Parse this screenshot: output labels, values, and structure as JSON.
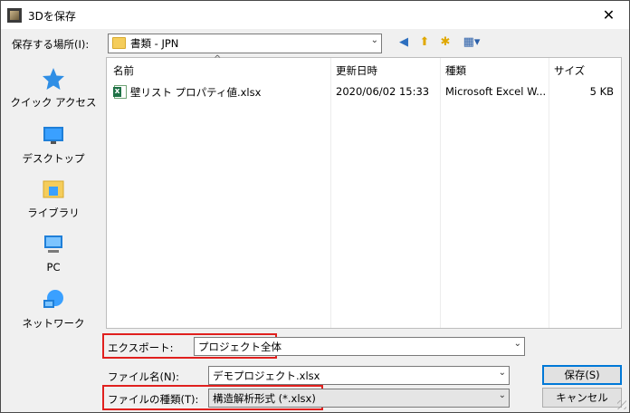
{
  "window": {
    "title": "3Dを保存",
    "close_glyph": "✕"
  },
  "location": {
    "label": "保存する場所(I):",
    "value": "書類 - JPN",
    "arrow": "⌄"
  },
  "toolbar": [
    {
      "name": "back-icon",
      "glyph": "◀",
      "color": "#2d6fbf"
    },
    {
      "name": "up-folder-icon",
      "glyph": "⬆",
      "color": "#e0a800"
    },
    {
      "name": "new-folder-icon",
      "glyph": "✱",
      "color": "#e0a800"
    },
    {
      "name": "view-menu-icon",
      "glyph": "▦▾",
      "color": "#2a5fa8"
    }
  ],
  "places": [
    {
      "name": "quick-access",
      "label": "クイック アクセス"
    },
    {
      "name": "desktop",
      "label": "デスクトップ"
    },
    {
      "name": "library",
      "label": "ライブラリ"
    },
    {
      "name": "pc",
      "label": "PC"
    },
    {
      "name": "network",
      "label": "ネットワーク"
    }
  ],
  "file_list": {
    "sort_glyph": "^",
    "columns": [
      "名前",
      "更新日時",
      "種類",
      "サイズ"
    ],
    "rows": [
      {
        "name": "壁リスト プロパティ値.xlsx",
        "modified": "2020/06/02 15:33",
        "type": "Microsoft Excel W...",
        "size": "5 KB"
      }
    ]
  },
  "export": {
    "label": "エクスポート:",
    "value": "プロジェクト全体",
    "arrow": "⌄"
  },
  "filename": {
    "label": "ファイル名(N):",
    "value": "デモプロジェクト.xlsx",
    "arrow": "⌄"
  },
  "filetype": {
    "label": "ファイルの種類(T):",
    "value": "構造解析形式 (*.xlsx)",
    "arrow": "⌄"
  },
  "buttons": {
    "save": "保存(S)",
    "cancel": "キャンセル"
  },
  "colors": {
    "highlight_border": "#e0201e",
    "default_button_border": "#0078d7"
  }
}
